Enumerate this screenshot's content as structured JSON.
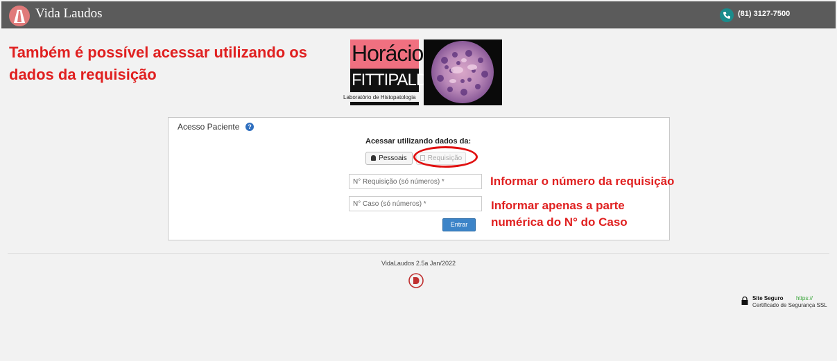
{
  "header": {
    "app_name": "Vida Laudos",
    "phone": "(81) 3127-7500",
    "brand_icon": "road-icon",
    "phone_icon": "phone-icon"
  },
  "annotations": {
    "main": "Também é possível acessar utilizando os dados da requisição",
    "requisition": "Informar o número da requisição",
    "case": "Informar apenas a parte numérica do N° do Caso",
    "color": "#e02020"
  },
  "logo": {
    "line1": "Horácio",
    "line2": "FITTIPALDI",
    "subtitle": "Laboratório de Histopatologia"
  },
  "panel": {
    "title": "Acesso Paciente",
    "help_icon": "?",
    "access_label": "Acessar utilizando dados da:",
    "btn_pessoais": "Pessoais",
    "btn_requisicao": "Requisição",
    "field_requisicao_placeholder": "N° Requisição (só números) *",
    "field_caso_placeholder": "N° Caso (só números) *",
    "field_requisicao_value": "",
    "field_caso_value": "",
    "submit": "Entrar"
  },
  "footer": {
    "version": "VidaLaudos 2.5a Jan/2022",
    "ssl_title": "Site Seguro",
    "ssl_https": "https://",
    "ssl_sub": "Certificado de Segurança SSL"
  }
}
